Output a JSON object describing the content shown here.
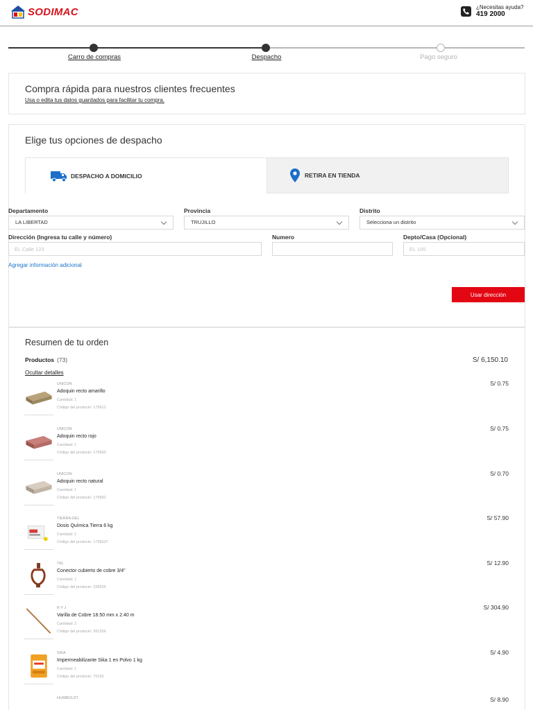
{
  "header": {
    "brand": "SODIMAC",
    "help_question": "¿Necesitas ayuda?",
    "help_phone": "419 2000"
  },
  "stepper": {
    "steps": [
      {
        "label": "Carro de compras",
        "state": "done"
      },
      {
        "label": "Despacho",
        "state": "current"
      },
      {
        "label": "Pago seguro",
        "state": "pending"
      }
    ]
  },
  "quick_buy": {
    "title": "Compra rápida para nuestros clientes frecuentes",
    "link": "Usa o edita tus datos guardados para facilitar tu compra."
  },
  "dispatch": {
    "title": "Elige tus opciones de despacho",
    "tabs": [
      {
        "label": "DESPACHO A DOMICILIO",
        "icon": "truck-icon",
        "active": true
      },
      {
        "label": "RETIRA EN TIENDA",
        "icon": "location-pin-icon",
        "active": false
      }
    ],
    "form": {
      "departamento_label": "Departamento",
      "departamento_value": "LA LIBERTAD",
      "provincia_label": "Provincia",
      "provincia_value": "TRUJILLO",
      "distrito_label": "Distrito",
      "distrito_value": "Selecciona un distrito",
      "direccion_label": "Dirección (Ingresa tu calle y número)",
      "direccion_placeholder": "EL Calle 123",
      "numero_label": "Numero",
      "numero_placeholder": "",
      "depto_label": "Depto/Casa (Opcional)",
      "depto_placeholder": "EL 100",
      "add_info": "Agregar información adicional",
      "use_address": "Usar dirección"
    }
  },
  "summary": {
    "title": "Resumen de tu orden",
    "products_label": "Productos",
    "products_count": "(73)",
    "total": "S/ 6,150.10",
    "hide_details": "Ocultar detalles",
    "items": [
      {
        "brand": "UNICON",
        "name": "Adoquin recto amarillo",
        "qty": "Cantidad: 1",
        "code": "Código del producto: 179612",
        "price": "S/ 0.75",
        "icon": "paver-yellow-icon"
      },
      {
        "brand": "UNICON",
        "name": "Adoquin recto rojo",
        "qty": "Cantidad: 1",
        "code": "Código del producto: 179590",
        "price": "S/ 0.75",
        "icon": "paver-red-icon"
      },
      {
        "brand": "UNICON",
        "name": "Adoquin recto natural",
        "qty": "Cantidad: 1",
        "code": "Código del producto: 179582",
        "price": "S/ 0.70",
        "icon": "paver-natural-icon"
      },
      {
        "brand": "TIERRA GEL",
        "name": "Dosis Química Tierra 6 kg",
        "qty": "Cantidad: 1",
        "code": "Código del producto: 1735637",
        "price": "S/ 57.90",
        "icon": "chemical-box-icon"
      },
      {
        "brand": "TKL",
        "name": "Conector cubierto de cobre 3/4\"",
        "qty": "Cantidad: 1",
        "code": "Código del producto: 328235",
        "price": "S/ 12.90",
        "icon": "copper-connector-icon"
      },
      {
        "brand": "R Y J",
        "name": "Varilla de Cobre 18.50 mm x 2.40 m",
        "qty": "Cantidad: 2",
        "code": "Código del producto: 361356",
        "price": "S/ 304.90",
        "icon": "copper-rod-icon"
      },
      {
        "brand": "SIKA",
        "name": "Impermeabilizante Sika 1 en Polvo 1 kg",
        "qty": "Cantidad: 1",
        "code": "Código del producto: 75163",
        "price": "S/ 4.90",
        "icon": "powder-bag-icon"
      },
      {
        "brand": "HUMBOLDT",
        "name": "",
        "qty": "",
        "code": "",
        "price": "S/ 8.90",
        "icon": ""
      }
    ]
  },
  "colors": {
    "brand_red": "#e30613",
    "link_blue": "#1a73c8",
    "icon_blue": "#1d6fc9"
  }
}
